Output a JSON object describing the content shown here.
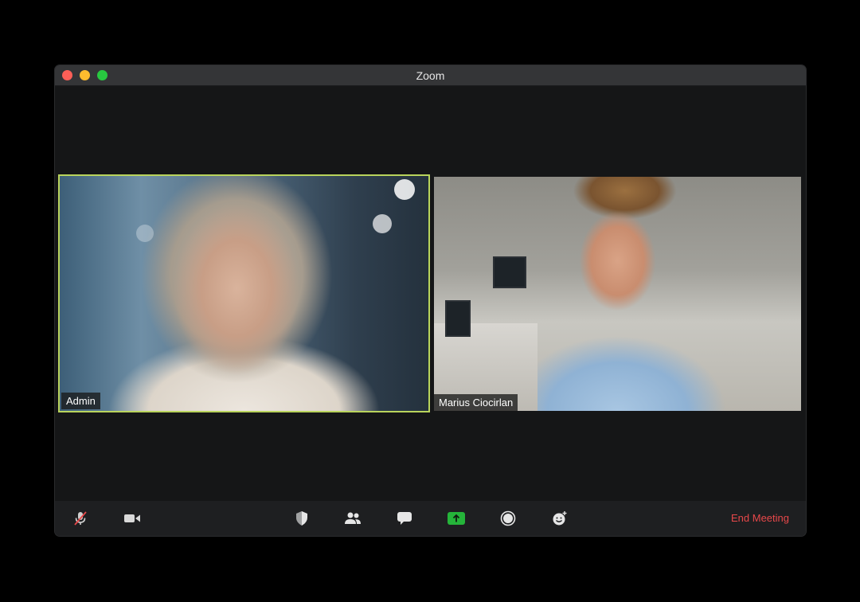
{
  "window": {
    "title": "Zoom"
  },
  "participants": [
    {
      "name": "Admin",
      "active_speaker": true
    },
    {
      "name": "Marius Ciocirlan",
      "active_speaker": false
    }
  ],
  "toolbar": {
    "buttons": [
      {
        "icon": "microphone-muted-icon"
      },
      {
        "icon": "video-camera-icon"
      },
      {
        "icon": "security-shield-icon"
      },
      {
        "icon": "participants-icon"
      },
      {
        "icon": "chat-icon"
      },
      {
        "icon": "share-screen-icon"
      },
      {
        "icon": "record-icon"
      },
      {
        "icon": "reactions-icon"
      }
    ],
    "end_meeting_label": "End Meeting"
  },
  "colors": {
    "active_speaker_border": "#b9d45c",
    "end_meeting": "#e8484a",
    "share_screen": "#25b43a"
  }
}
